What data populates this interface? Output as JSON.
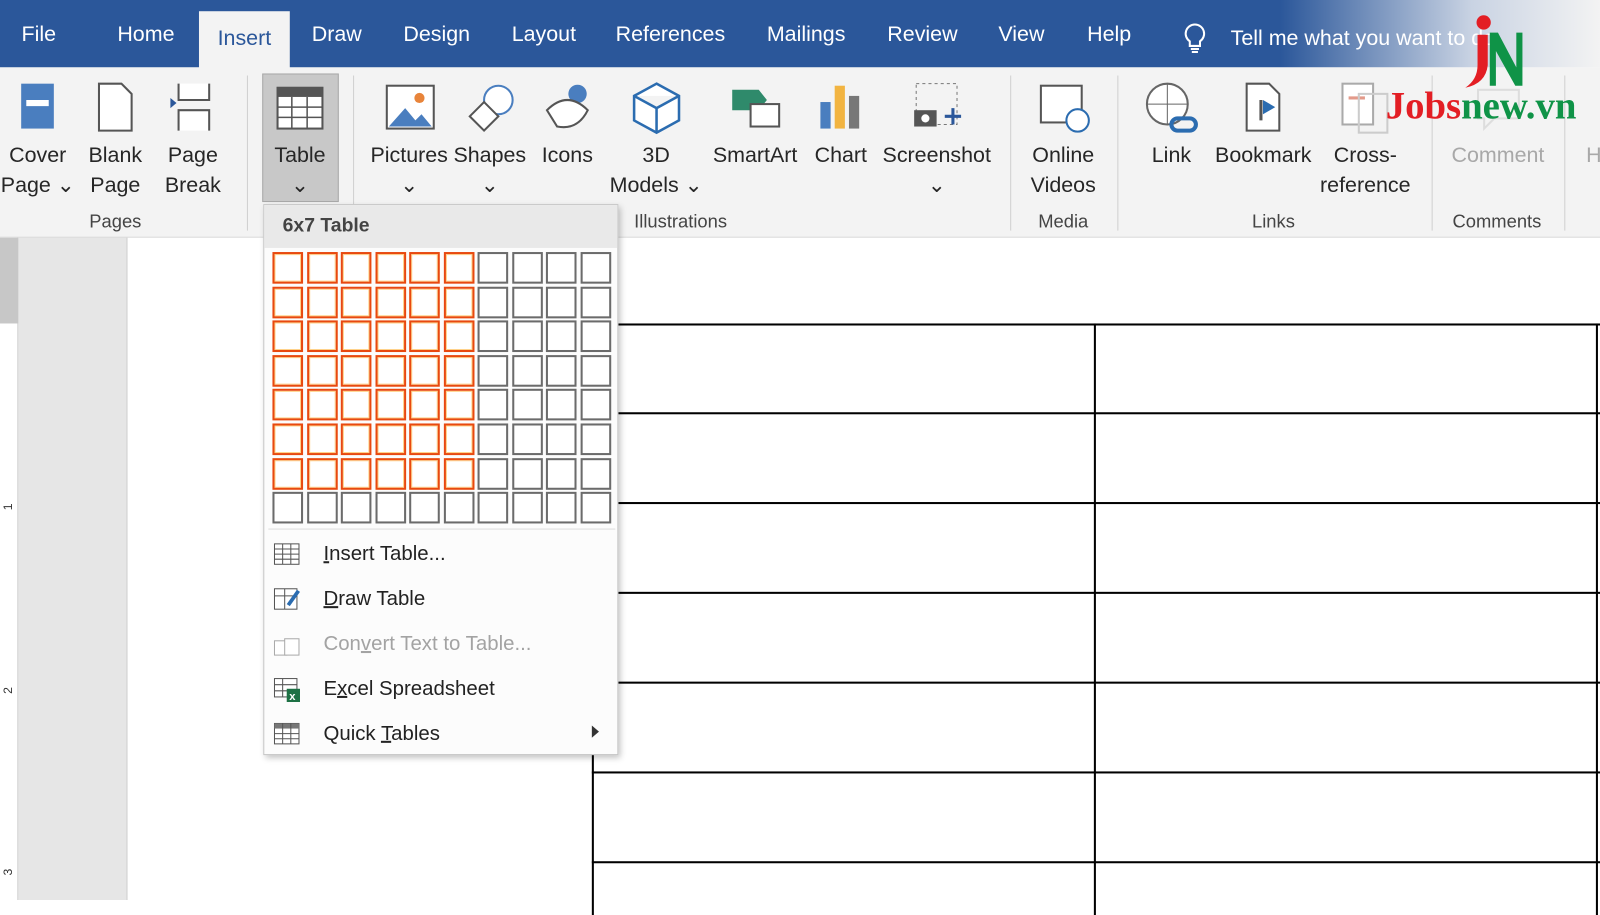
{
  "tabs": [
    "File",
    "Home",
    "Insert",
    "Draw",
    "Design",
    "Layout",
    "References",
    "Mailings",
    "Review",
    "View",
    "Help"
  ],
  "active_tab": "Insert",
  "tell_me": "Tell me what you want to do",
  "ribbon": {
    "buttons": [
      {
        "id": "cover-page",
        "l1": "Cover",
        "l2": "Page ⌄",
        "icon": "cover-page-icon"
      },
      {
        "id": "blank-page",
        "l1": "Blank",
        "l2": "Page",
        "icon": "blank-page-icon"
      },
      {
        "id": "page-break",
        "l1": "Page",
        "l2": "Break",
        "icon": "page-break-icon"
      },
      {
        "id": "table",
        "l1": "Table",
        "l2": "⌄",
        "icon": "table-icon"
      },
      {
        "id": "pictures",
        "l1": "Pictures",
        "l2": "⌄",
        "icon": "pictures-icon"
      },
      {
        "id": "shapes",
        "l1": "Shapes",
        "l2": "⌄",
        "icon": "shapes-icon"
      },
      {
        "id": "icons",
        "l1": "Icons",
        "l2": "",
        "icon": "icons-icon"
      },
      {
        "id": "3d-models",
        "l1": "3D",
        "l2": "Models ⌄",
        "icon": "3d-models-icon"
      },
      {
        "id": "smartart",
        "l1": "SmartArt",
        "l2": "",
        "icon": "smartart-icon"
      },
      {
        "id": "chart",
        "l1": "Chart",
        "l2": "",
        "icon": "chart-icon"
      },
      {
        "id": "screenshot",
        "l1": "Screenshot",
        "l2": "⌄",
        "icon": "screenshot-icon"
      },
      {
        "id": "online-videos",
        "l1": "Online",
        "l2": "Videos",
        "icon": "online-videos-icon"
      },
      {
        "id": "link",
        "l1": "Link",
        "l2": "",
        "icon": "link-icon"
      },
      {
        "id": "bookmark",
        "l1": "Bookmark",
        "l2": "",
        "icon": "bookmark-icon"
      },
      {
        "id": "cross-reference",
        "l1": "Cross-",
        "l2": "reference",
        "icon": "cross-reference-icon"
      },
      {
        "id": "comment",
        "l1": "Comment",
        "l2": "",
        "icon": "comment-icon",
        "disabled": true
      },
      {
        "id": "header",
        "l1": "H",
        "l2": "",
        "icon": "header-icon",
        "disabled": true
      }
    ],
    "groups": [
      "Pages",
      "Illustrations",
      "Media",
      "Links",
      "Comments"
    ]
  },
  "table_menu": {
    "title": "6x7 Table",
    "grid": {
      "cols": 10,
      "rows": 8,
      "selected_cols": 6,
      "selected_rows": 7
    },
    "items": [
      {
        "pre": "",
        "key": "I",
        "post": "nsert Table...",
        "icon": "insert-table-icon"
      },
      {
        "pre": "",
        "key": "D",
        "post": "raw Table",
        "icon": "draw-table-icon"
      },
      {
        "pre": "Con",
        "key": "v",
        "post": "ert Text to Table...",
        "icon": "convert-text-icon",
        "disabled": true
      },
      {
        "pre": "E",
        "key": "x",
        "post": "cel Spreadsheet",
        "icon": "excel-spreadsheet-icon"
      },
      {
        "pre": "Quick ",
        "key": "T",
        "post": "ables",
        "icon": "quick-tables-icon",
        "submenu": true
      }
    ]
  },
  "ruler_labels": [
    "1",
    "2",
    "3"
  ],
  "watermark": {
    "text": "Jobsnew.vn",
    "mark": "JN",
    "colors": {
      "red": "#e31e24",
      "green": "#0f9347"
    }
  },
  "colors": {
    "accent": "#2b579a",
    "grid_highlight": "#e8490f"
  }
}
